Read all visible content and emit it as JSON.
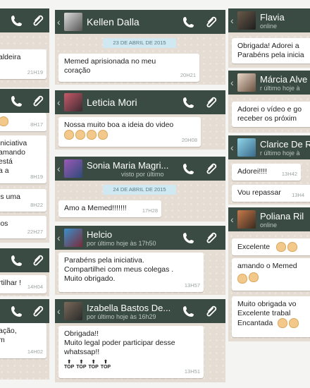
{
  "icons": {
    "back": "back-arrow-icon",
    "call": "phone-icon",
    "attach": "paperclip-icon"
  },
  "colors": {
    "bar": "#3a4b43",
    "chat_bg": "#e5ddd3",
    "bubble": "#ffffff",
    "date_chip": "#cfe8f2"
  },
  "left": {
    "c1": {
      "m1_text": "aldeira",
      "m1_time": "21H19"
    },
    "c2": {
      "m1_text": "",
      "m2_time": "8H17",
      "m3_text": "iniciativa\namando\nestá\na a",
      "m3_time": "8H19",
      "m4_text": "is uma",
      "m4_time": "8H22",
      "m5_text": "ios",
      "m5_time": "22H27"
    },
    "c3": {
      "m1_text": "rtilhar !",
      "m1_time": "14H04"
    },
    "c4": {
      "m1_text": "ação,\nm",
      "m1_time": "14H02"
    }
  },
  "middle": {
    "kellen": {
      "name": "Kellen Dalla",
      "date": "23 DE ABRIL DE 2015",
      "m1_text": "Memed aprisionada no meu\ncoração",
      "m1_time": "20H21"
    },
    "leticia": {
      "name": "Leticia Mori",
      "m1_text": "Nossa muito boa a ideia do video",
      "m1_time": "20H08"
    },
    "sonia": {
      "name": "Sonia Maria Magri...",
      "status": "visto por último",
      "date": "24 DE ABRIL DE 2015",
      "m1_text": "Amo a Memed!!!!!!!",
      "m1_time": "17H28"
    },
    "helcio": {
      "name": "Helcio",
      "status": "por último hoje às 17h50",
      "m1_text": "Parabéns pela iniciativa.\nCompartilhei com meus colegas .\nMuito obrigado.",
      "m1_time": "13H57"
    },
    "izabella": {
      "name": "Izabella Bastos De...",
      "status": "por último hoje às 16h29",
      "m1_text": "Obrigada!!\nMuito legal poder participar desse\nwhatssap!!",
      "top_label": "TOP",
      "m1_time": "13H51"
    }
  },
  "right": {
    "flavia": {
      "name": "Flavia",
      "status": "online",
      "m1_text": "Obrigada! Adorei a\nParabéns pela inicia"
    },
    "marcia": {
      "name": "Márcia Alve",
      "status": "r último hoje à",
      "m1_text": "Adorei o vídeo e go\nreceber os próxim"
    },
    "clarice": {
      "name": "Clarice De R",
      "status": "r último hoje à",
      "m1_text": "Adorei!!!!",
      "m1_time": "13H42",
      "m2_text": "Vou repassar",
      "m2_time": "13H4"
    },
    "poliana": {
      "name": "Poliana Ril",
      "status": "online",
      "m1_text": "Excelente",
      "m2_text": "amando o Memed",
      "m3_text": "Muito obrigada vo\nExcelente trabal",
      "m4_text": "Encantada"
    }
  }
}
